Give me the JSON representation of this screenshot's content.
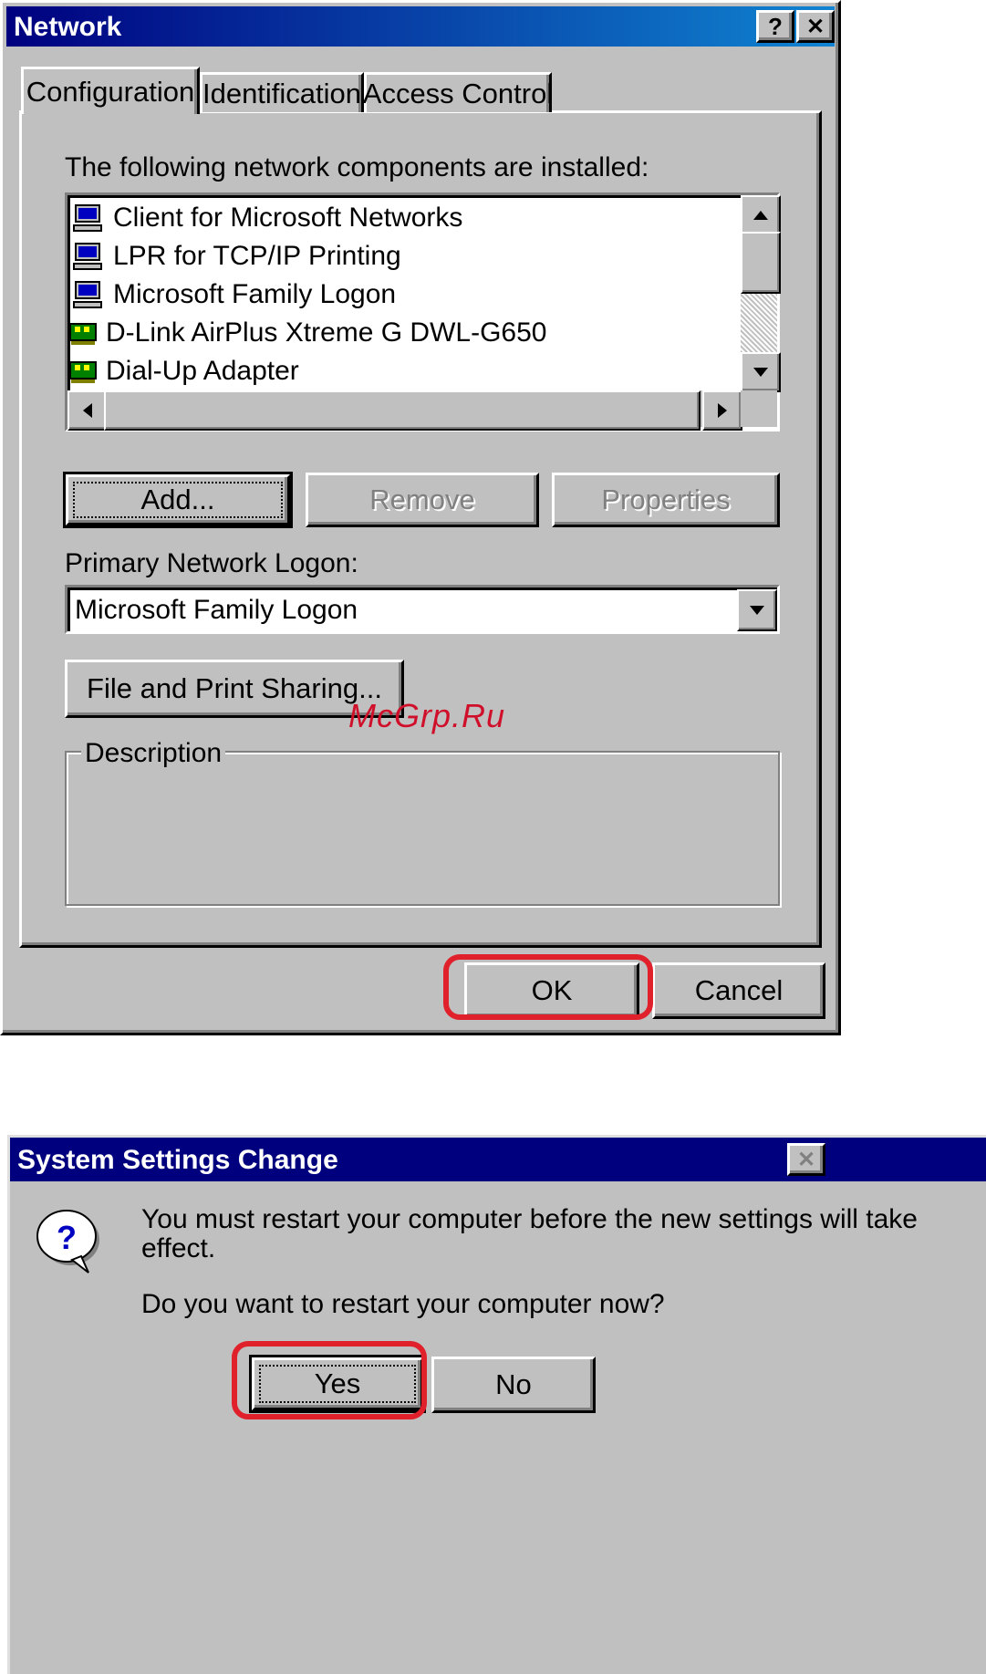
{
  "network_dialog": {
    "title": "Network",
    "help_glyph": "?",
    "close_glyph": "✕",
    "tabs": [
      {
        "label": "Configuration",
        "active": true
      },
      {
        "label": "Identification",
        "active": false
      },
      {
        "label": "Access Control",
        "active": false
      }
    ],
    "components_label": "The following network components are installed:",
    "components": [
      {
        "label": "Client for Microsoft Networks",
        "icon": "network-client-icon"
      },
      {
        "label": "LPR for TCP/IP Printing",
        "icon": "network-client-icon"
      },
      {
        "label": "Microsoft Family Logon",
        "icon": "network-client-icon"
      },
      {
        "label": "D-Link AirPlus Xtreme G DWL-G650",
        "icon": "network-adapter-icon"
      },
      {
        "label": "Dial-Up Adapter",
        "icon": "network-adapter-icon"
      }
    ],
    "buttons": {
      "add": "Add...",
      "remove": "Remove",
      "properties": "Properties",
      "file_print": "File and Print Sharing...",
      "ok": "OK",
      "cancel": "Cancel"
    },
    "primary_logon_label": "Primary Network Logon:",
    "primary_logon_value": "Microsoft Family Logon",
    "description_label": "Description"
  },
  "watermark": "McGrp.Ru",
  "restart_dialog": {
    "title": "System Settings Change",
    "close_glyph": "✕",
    "message_line1": "You must restart your computer before the new settings will take",
    "message_line2": "effect.",
    "question": "Do you want to restart your computer now?",
    "yes": "Yes",
    "no": "No"
  },
  "colors": {
    "face": "#c0c0c0",
    "title_active": "#00007f",
    "highlight_frame": "#e0202a",
    "watermark": "#d0102a"
  }
}
